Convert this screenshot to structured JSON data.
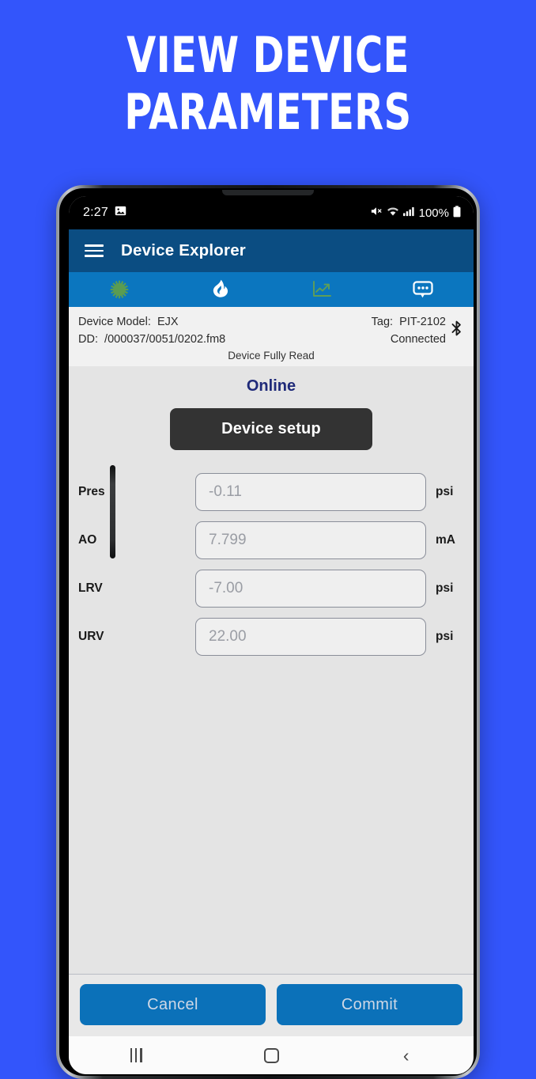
{
  "promo": {
    "line1": "VIEW DEVICE",
    "line2": "PARAMETERS",
    "background_color": "#3355FB"
  },
  "status_bar": {
    "time": "2:27",
    "photo_icon": "image-icon",
    "mute_icon": "mute-icon",
    "wifi_icon": "wifi-icon",
    "signal_icon": "signal-bars-icon",
    "battery_percent": "100%",
    "battery_icon": "battery-full-icon"
  },
  "app_bar": {
    "menu_icon": "hamburger-menu-icon",
    "title": "Device Explorer",
    "background_color": "#0B4D82"
  },
  "tabs": [
    {
      "name": "tab-process-variables",
      "icon": "gear-sunburst-icon",
      "glyph": "☀",
      "color": "#5a9c52"
    },
    {
      "name": "tab-diagnostics",
      "icon": "flame-icon",
      "glyph": "🔥",
      "color": "#ffffff"
    },
    {
      "name": "tab-trend",
      "icon": "chart-line-icon",
      "glyph": "📈",
      "color": "#5f9e57"
    },
    {
      "name": "tab-messages",
      "icon": "message-bubble-icon",
      "glyph": "💬",
      "color": "#ffffff"
    }
  ],
  "device_info": {
    "model_label": "Device Model:",
    "model_value": "EJX",
    "dd_label": "DD:",
    "dd_value": "/000037/0051/0202.fm8",
    "tag_label": "Tag:",
    "tag_value": "PIT-2102",
    "connection_status": "Connected",
    "bluetooth_icon": "bluetooth-icon",
    "read_status": "Device Fully Read"
  },
  "main": {
    "online_status": "Online",
    "online_color": "#1F2A79",
    "setup_button_label": "Device setup",
    "parameters": [
      {
        "label": "Pres",
        "value": "-0.11",
        "unit": "psi"
      },
      {
        "label": "AO",
        "value": "7.799",
        "unit": "mA"
      },
      {
        "label": "LRV",
        "value": "-7.00",
        "unit": "psi"
      },
      {
        "label": "URV",
        "value": "22.00",
        "unit": "psi"
      }
    ]
  },
  "actions": {
    "cancel_label": "Cancel",
    "commit_label": "Commit",
    "button_color": "#0B71B9"
  },
  "nav_bar": {
    "recents_icon": "recents-icon",
    "home_icon": "home-icon",
    "back_icon": "back-icon",
    "back_glyph": "‹"
  }
}
